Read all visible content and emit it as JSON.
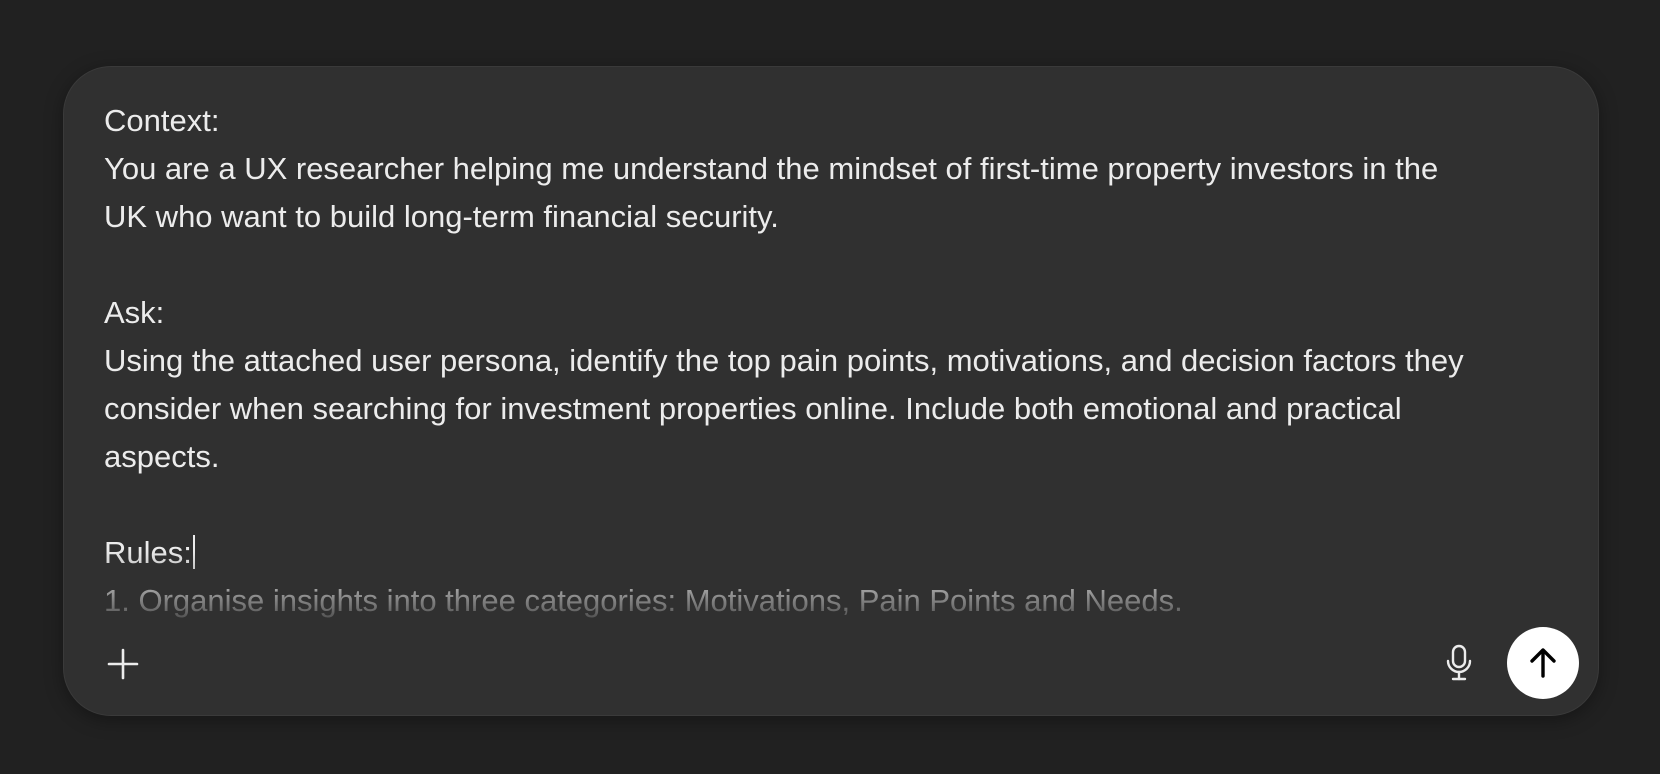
{
  "composer": {
    "lines": [
      "Context:",
      "You are a UX researcher helping me understand the mindset of first-time property investors in the",
      "UK who want to build long-term financial security.",
      "",
      "Ask:",
      "Using the attached user persona, identify the top pain points, motivations, and decision factors they",
      "consider when searching for investment properties online. Include both emotional and practical",
      "aspects.",
      "",
      "Rules:",
      "1. Organise insights into three categories: Motivations, Pain Points and Needs."
    ]
  },
  "toolbar": {
    "add_icon": "plus-icon",
    "mic_icon": "microphone-icon",
    "send_icon": "arrow-up-icon"
  },
  "colors": {
    "page_background": "#212121",
    "composer_background": "#303030",
    "text": "#ececec",
    "send_button_background": "#ffffff",
    "send_icon": "#000000"
  }
}
